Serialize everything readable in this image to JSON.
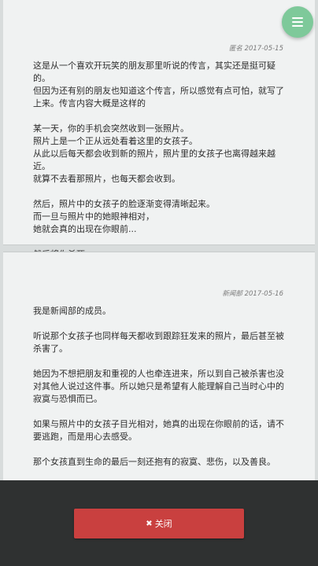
{
  "posts": [
    {
      "author": "匿名",
      "date": "2017-05-15",
      "paragraphs": [
        "这是从一个喜欢开玩笑的朋友那里听说的传言，其实还是挺可疑的。\n但因为还有别的朋友也知道这个传言，所以感觉有点可怕，就写了上来。传言内容大概是这样的",
        "某一天，你的手机会突然收到一张照片。\n照片上是一个正从远处看着这里的女孩子。\n从此以后每天都会收到新的照片，照片里的女孩子也离得越来越近。\n就算不去看那照片，也每天都会收到。",
        "然后，照片中的女孩子的脸逐渐变得清晰起来。\n而一旦与照片中的她眼神相对，\n她就会真的出现在你眼前...",
        "然后将你杀死。"
      ]
    },
    {
      "author": "新闻部",
      "date": "2017-05-16",
      "paragraphs": [
        "我是新闻部的成员。",
        "听说那个女孩子也同样每天都收到跟踪狂发来的照片，最后甚至被杀害了。",
        "她因为不想把朋友和重视的人也牵连进来，所以到自己被杀害也没对其他人说过这件事。所以她只是希望有人能理解自己当时心中的寂寞与恐惧而已。",
        "如果与照片中的女孩子目光相对，她真的出现在你眼前的话，请不要逃跑，而是用心去感受。",
        "那个女孩直到生命的最后一刻还抱有的寂寞、悲伤，以及善良。"
      ]
    }
  ],
  "fab": {
    "icon": "menu-icon",
    "color": "#7ec99a"
  },
  "footer": {
    "close_label": "关闭",
    "close_icon": "close-icon",
    "button_color": "#c9403f"
  }
}
